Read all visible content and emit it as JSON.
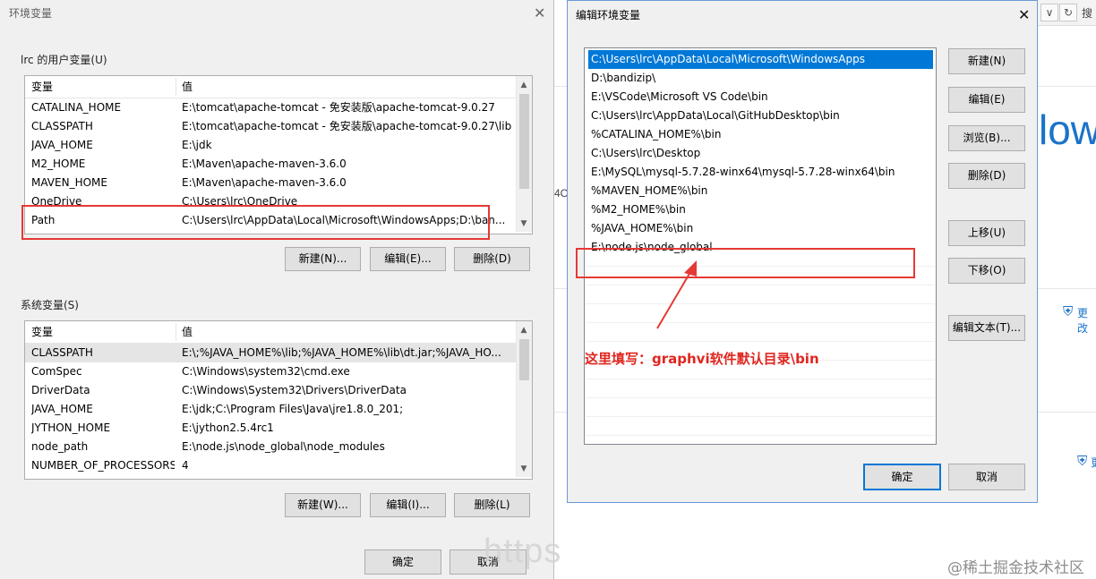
{
  "background": {
    "tab_fragment": "搜",
    "refresh_icon": "refresh-icon",
    "big_text": "low",
    "fragment_4c": "4C",
    "change_link_1": "更改",
    "change_link_2": "更",
    "shield_icon": "uac-shield-icon"
  },
  "env_dialog": {
    "title": "环境变量",
    "user_group_label": "lrc 的用户变量(U)",
    "system_group_label": "系统变量(S)",
    "col_variable": "变量",
    "col_value": "值",
    "user_vars": [
      {
        "name": "CATALINA_HOME",
        "value": "E:\\tomcat\\apache-tomcat - 免安装版\\apache-tomcat-9.0.27"
      },
      {
        "name": "CLASSPATH",
        "value": "E:\\tomcat\\apache-tomcat - 免安装版\\apache-tomcat-9.0.27\\lib"
      },
      {
        "name": "JAVA_HOME",
        "value": "E:\\jdk"
      },
      {
        "name": "M2_HOME",
        "value": "E:\\Maven\\apache-maven-3.6.0"
      },
      {
        "name": "MAVEN_HOME",
        "value": "E:\\Maven\\apache-maven-3.6.0"
      },
      {
        "name": "OneDrive",
        "value": "C:\\Users\\lrc\\OneDrive"
      },
      {
        "name": "Path",
        "value": "C:\\Users\\lrc\\AppData\\Local\\Microsoft\\WindowsApps;D:\\ban..."
      }
    ],
    "system_vars": [
      {
        "name": "CLASSPATH",
        "value": "E:\\;%JAVA_HOME%\\lib;%JAVA_HOME%\\lib\\dt.jar;%JAVA_HO..."
      },
      {
        "name": "ComSpec",
        "value": "C:\\Windows\\system32\\cmd.exe"
      },
      {
        "name": "DriverData",
        "value": "C:\\Windows\\System32\\Drivers\\DriverData"
      },
      {
        "name": "JAVA_HOME",
        "value": "E:\\jdk;C:\\Program Files\\Java\\jre1.8.0_201;"
      },
      {
        "name": "JYTHON_HOME",
        "value": "E:\\jython2.5.4rc1"
      },
      {
        "name": "node_path",
        "value": "E:\\node.js\\node_global\\node_modules"
      },
      {
        "name": "NUMBER_OF_PROCESSORS",
        "value": "4"
      }
    ],
    "user_buttons": {
      "new": "新建(N)...",
      "edit": "编辑(E)...",
      "delete": "删除(D)"
    },
    "system_buttons": {
      "new": "新建(W)...",
      "edit": "编辑(I)...",
      "delete": "删除(L)"
    },
    "ok": "确定",
    "cancel": "取消"
  },
  "edit_dialog": {
    "title": "编辑环境变量",
    "paths": [
      "C:\\Users\\lrc\\AppData\\Local\\Microsoft\\WindowsApps",
      "D:\\bandizip\\",
      "E:\\VSCode\\Microsoft VS Code\\bin",
      "C:\\Users\\lrc\\AppData\\Local\\GitHubDesktop\\bin",
      "%CATALINA_HOME%\\bin",
      "C:\\Users\\lrc\\Desktop",
      "E:\\MySQL\\mysql-5.7.28-winx64\\mysql-5.7.28-winx64\\bin",
      "%MAVEN_HOME%\\bin",
      "%M2_HOME%\\bin",
      "%JAVA_HOME%\\bin",
      "E:\\node.js\\node_global"
    ],
    "buttons": {
      "new": "新建(N)",
      "edit": "编辑(E)",
      "browse": "浏览(B)...",
      "delete": "删除(D)",
      "move_up": "上移(U)",
      "move_down": "下移(O)",
      "edit_text": "编辑文本(T)..."
    },
    "ok": "确定",
    "cancel": "取消"
  },
  "annotation": {
    "text": "这里填写：graphvi软件默认目录\\bin",
    "color": "#e53935"
  },
  "watermark": {
    "left": "https",
    "right": "@稀土掘金技术社区"
  }
}
